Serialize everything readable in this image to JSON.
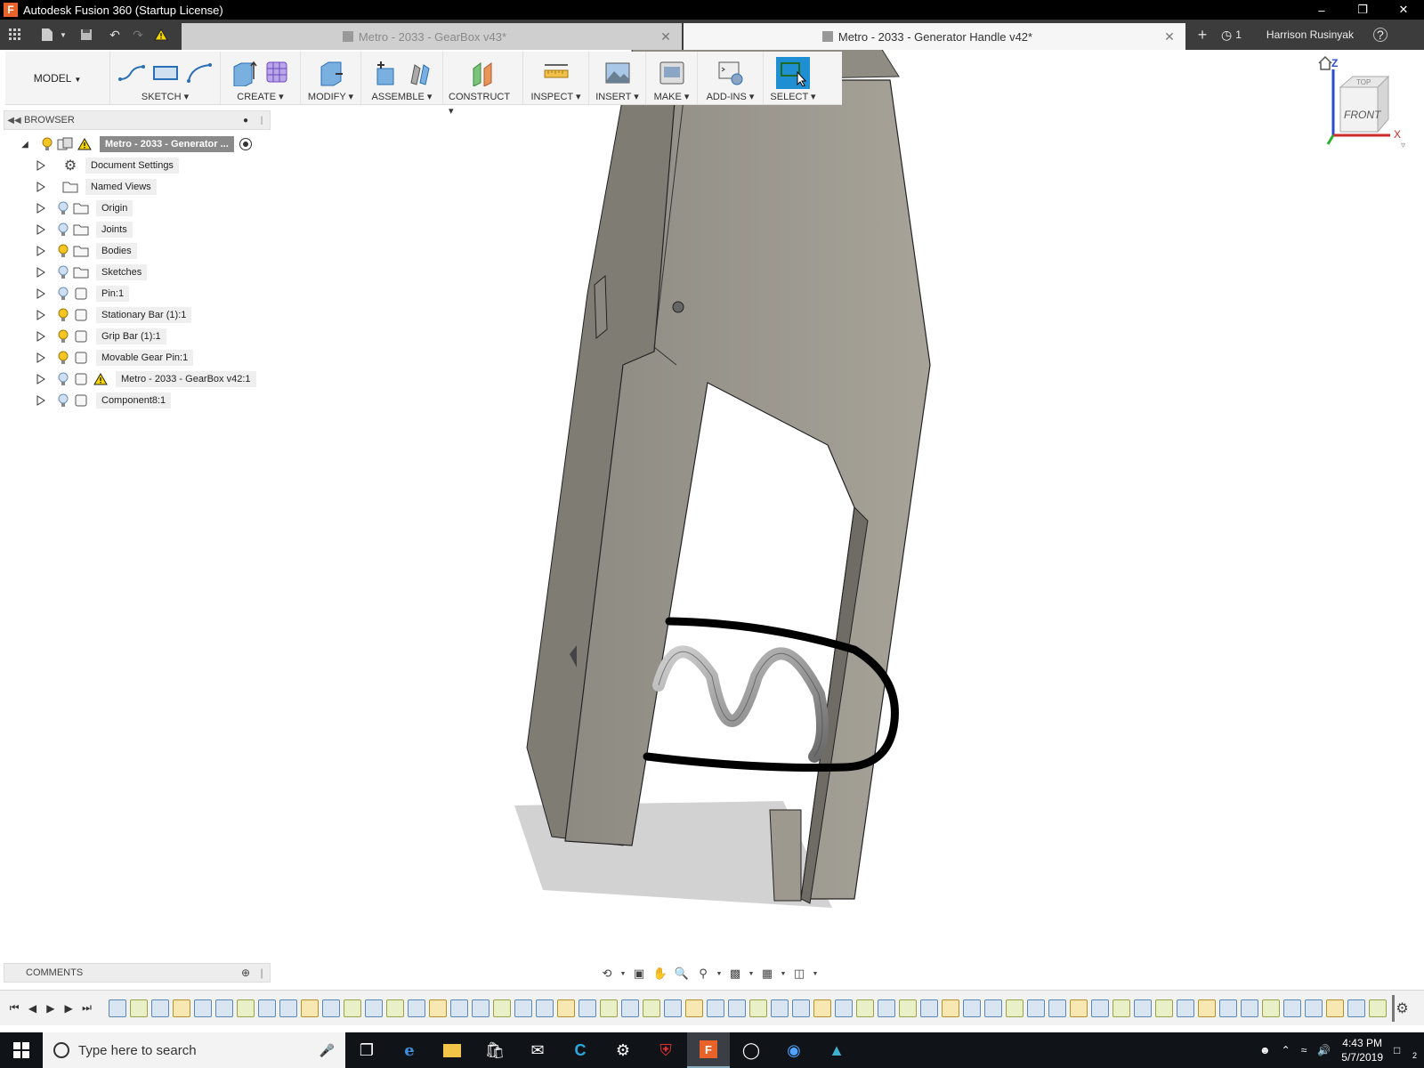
{
  "window": {
    "title": "Autodesk Fusion 360 (Startup License)",
    "app_icon_letter": "F"
  },
  "tabs": [
    {
      "label": "Metro - 2033 - GearBox v43*",
      "active": false
    },
    {
      "label": "Metro - 2033 - Generator Handle v42*",
      "active": true
    }
  ],
  "header_right": {
    "job_count": "1",
    "user": "Harrison Rusinyak",
    "help": "?"
  },
  "toolbar": {
    "workspace": "MODEL",
    "groups": [
      "SKETCH",
      "CREATE",
      "MODIFY",
      "ASSEMBLE",
      "CONSTRUCT",
      "INSPECT",
      "INSERT",
      "MAKE",
      "ADD-INS",
      "SELECT"
    ],
    "accent_color": "#1e8fd2"
  },
  "browser": {
    "title": "BROWSER",
    "root": "Metro - 2033 - Generator ...",
    "items": [
      {
        "label": "Document Settings",
        "icon": "gear-icon",
        "bulb": "none"
      },
      {
        "label": "Named Views",
        "icon": "folder-icon",
        "bulb": "none"
      },
      {
        "label": "Origin",
        "icon": "folder-icon",
        "bulb": "off"
      },
      {
        "label": "Joints",
        "icon": "folder-icon",
        "bulb": "off"
      },
      {
        "label": "Bodies",
        "icon": "folder-icon",
        "bulb": "on"
      },
      {
        "label": "Sketches",
        "icon": "folder-icon",
        "bulb": "off"
      },
      {
        "label": "Pin:1",
        "icon": "component-icon",
        "bulb": "off"
      },
      {
        "label": "Stationary Bar (1):1",
        "icon": "component-icon",
        "bulb": "on"
      },
      {
        "label": "Grip Bar (1):1",
        "icon": "component-icon",
        "bulb": "on"
      },
      {
        "label": "Movable Gear Pin:1",
        "icon": "component-icon",
        "bulb": "on"
      },
      {
        "label": "Metro - 2033 - GearBox v42:1",
        "icon": "component-icon",
        "bulb": "off",
        "warning": true
      },
      {
        "label": "Component8:1",
        "icon": "component-icon",
        "bulb": "off"
      }
    ]
  },
  "comments": {
    "title": "COMMENTS"
  },
  "viewcube": {
    "face": "FRONT",
    "top": "TOP",
    "axis_z": "Z",
    "axis_x": "X"
  },
  "taskbar": {
    "search_placeholder": "Type here to search",
    "time": "4:43 PM",
    "date": "5/7/2019",
    "notifications": "2"
  }
}
